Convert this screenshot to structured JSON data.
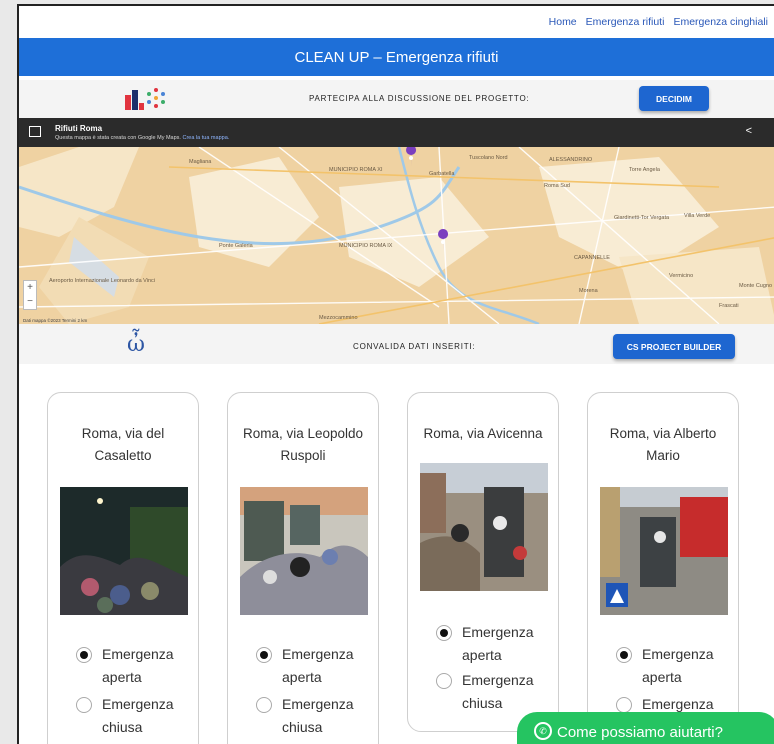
{
  "nav": {
    "home": "Home",
    "rifiuti": "Emergenza rifiuti",
    "cinghiali": "Emergenza cinghiali"
  },
  "header": {
    "title": "CLEAN UP – Emergenza rifiuti"
  },
  "participate": {
    "text": "PARTECIPA ALLA DISCUSSIONE DEL PROGETTO:",
    "button": "DECIDIM"
  },
  "map": {
    "title": "Rifiuti Roma",
    "subtitle": "Questa mappa è stata creata con Google My Maps.",
    "subtitle_link": "Crea la tua mappa.",
    "labels": [
      "Magliana",
      "MUNICIPIO ROMA XI",
      "Garbatella",
      "Tuscolano Nord",
      "Torre Angela",
      "Roma Sud",
      "Giardinetti-Tor Vergata",
      "Villa Verde",
      "Aeroporto Internazionale Leonardo da Vinci",
      "Ponte Galeria",
      "Monte Cugno",
      "MUNICIPIO ROMA IX",
      "ALESSANDRINO",
      "CAPANNELLE",
      "Morena",
      "Mezzocammino",
      "Frascati",
      "Vermicino"
    ],
    "footer": "Dati mappa ©2023  Termini  2 km"
  },
  "validate": {
    "text": "CONVALIDA DATI INSERITI:",
    "button": "CS PROJECT BUILDER"
  },
  "cards": [
    {
      "location": "Roma, via del Casaletto",
      "opt_open": "Emergenza aperta",
      "opt_closed": "Emergenza chiusa"
    },
    {
      "location": "Roma, via Leopoldo Ruspoli",
      "opt_open": "Emergenza aperta",
      "opt_closed": "Emergenza chiusa"
    },
    {
      "location": "Roma, via Avicenna",
      "opt_open": "Emergenza aperta",
      "opt_closed": "Emergenza chiusa"
    },
    {
      "location": "Roma, via Alberto Mario",
      "opt_open": "Emergenza aperta",
      "opt_closed": "Emergenza chiusa"
    }
  ],
  "chat": {
    "label": "Come possiamo aiutarti?"
  },
  "colors": {
    "primary": "#1e6fd8",
    "chat": "#25c461",
    "map_land": "#efd2a2",
    "map_pin": "#7b3fbf"
  }
}
